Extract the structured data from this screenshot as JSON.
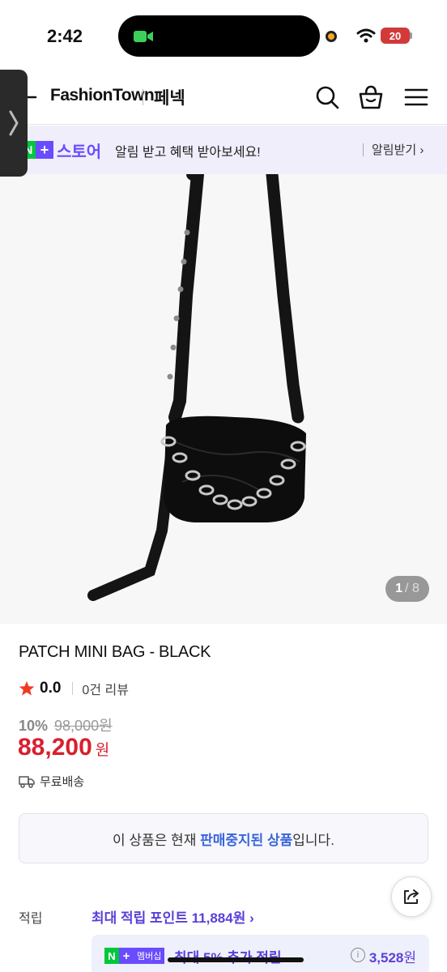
{
  "status_bar": {
    "time": "2:42",
    "battery": "20"
  },
  "header": {
    "brand": "FashionTown",
    "store_name": "페넥"
  },
  "banner": {
    "badge_n": "N",
    "badge_plus": "+",
    "store_label": "스토어",
    "message": "알림 받고 혜택 받아보세요!",
    "link_label": "알림받기 ›"
  },
  "product": {
    "image_counter": {
      "current": "1",
      "total": "/ 8"
    },
    "title": "PATCH MINI BAG - BLACK",
    "rating": "0.0",
    "review_count": "0건 리뷰",
    "discount_rate": "10%",
    "original_price": "98,000원",
    "sale_price": "88,200",
    "price_unit": "원",
    "shipping": "무료배송"
  },
  "notice": {
    "prefix": "이 상품은 현재 ",
    "highlight": "판매중지된 상품",
    "suffix": "입니다."
  },
  "points": {
    "label": "적립",
    "link": "최대 적립 포인트 11,884원 ›"
  },
  "membership": {
    "badge_n": "N",
    "badge_plus": "+",
    "badge_tag": "멤버십",
    "text": "최대 5% 추가 적립",
    "info": "i",
    "value": "3,528",
    "unit": "원"
  },
  "colors": {
    "accent_purple": "#6a4cff",
    "price_red": "#d81f2e",
    "naver_green": "#00c73c",
    "notice_blue": "#3a66d9"
  },
  "icons": {
    "header": [
      "back-icon",
      "search-icon",
      "cart-icon",
      "menu-icon"
    ],
    "rating": "star-icon",
    "shipping": "truck-icon",
    "share": "share-icon"
  }
}
